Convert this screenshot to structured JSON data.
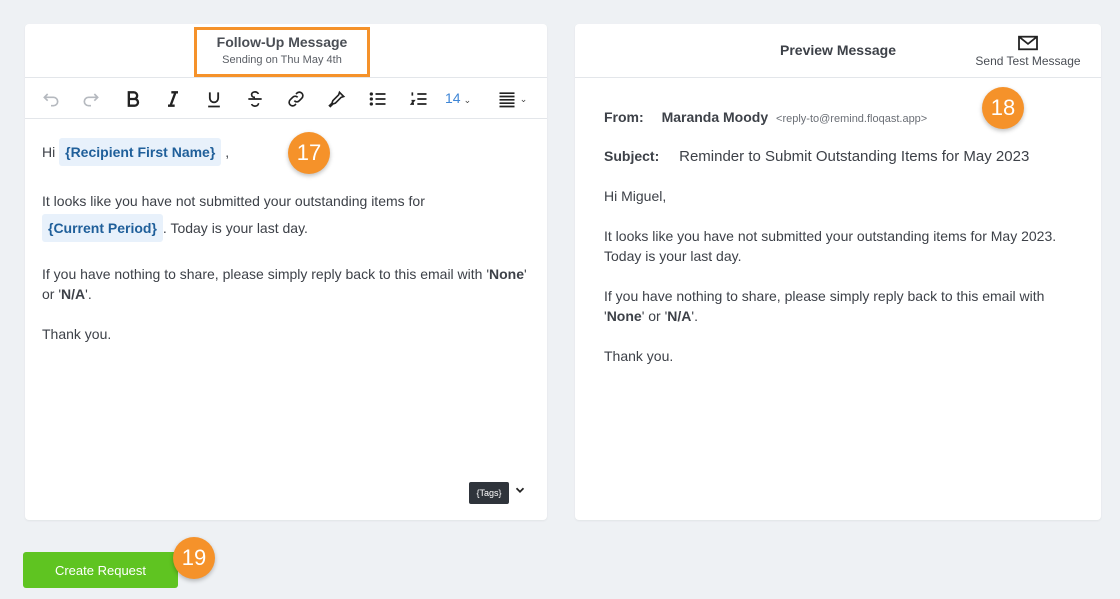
{
  "editor": {
    "title": "Follow-Up Message",
    "subtitle": "Sending on Thu May 4th",
    "toolbar": {
      "undo_icon": "undo-icon",
      "redo_icon": "redo-icon",
      "bold_icon": "bold-icon",
      "italic_icon": "italic-icon",
      "underline_icon": "underline-icon",
      "strike_icon": "strikethrough-icon",
      "link_icon": "link-icon",
      "color_icon": "eyedropper-icon",
      "bullet_icon": "bullet-list-icon",
      "number_icon": "numbered-list-icon",
      "font_size": "14",
      "align_icon": "align-justify-icon"
    },
    "body": {
      "greeting_prefix": "Hi",
      "recipient_tag": "{Recipient First Name}",
      "greeting_suffix": ",",
      "line2": "It looks like you have not submitted your outstanding items for",
      "period_tag": "{Current Period}",
      "line3_suffix": ". Today is your last day.",
      "line4_a": "If you have nothing to share, please simply reply back to this email with '",
      "line4_none": "None",
      "line4_b": "' or '",
      "line4_na": "N/A",
      "line4_c": "'.",
      "thanks": "Thank you."
    },
    "tags_button": "{Tags}"
  },
  "preview": {
    "title": "Preview Message",
    "send_test_label": "Send Test Message",
    "from_label": "From:",
    "from_name": "Maranda Moody",
    "from_email": "<reply-to@remind.floqast.app>",
    "subject_label": "Subject:",
    "subject": "Reminder to Submit Outstanding Items for May 2023",
    "greeting": "Hi Miguel,",
    "para1_line1": "It looks like you have not submitted your outstanding items for May 2023.",
    "para1_line2": "Today is your last day.",
    "para2_line1": "If you have nothing to share, please simply reply back to this email with",
    "para2_a": "'",
    "para2_none": "None",
    "para2_b": "' or '",
    "para2_na": "N/A",
    "para2_c": "'.",
    "thanks": "Thank you."
  },
  "badges": {
    "b17": "17",
    "b18": "18",
    "b19": "19"
  },
  "actions": {
    "create_request": "Create Request"
  },
  "colors": {
    "accent_orange": "#f5922a",
    "primary_green": "#5fc421",
    "tag_bg": "#e8f1fb",
    "tag_text": "#1f5f9a"
  }
}
